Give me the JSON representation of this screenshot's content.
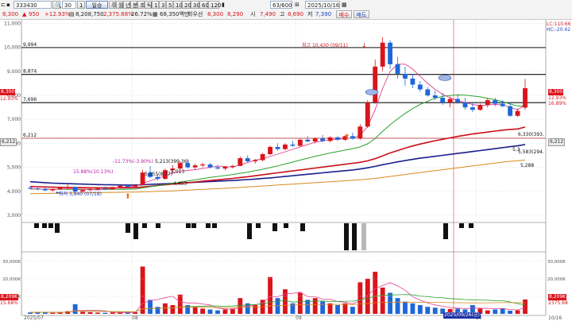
{
  "toolbar": {
    "code": "333430",
    "range": "30",
    "sub": "1",
    "price": "8,300",
    "change": "950",
    "change_pct": "+12.93%",
    "volume": "8,208,750",
    "vol_pct": "2,375.68%",
    "turnover": "26.72%",
    "amount": "68,350백만",
    "broker": "회우선",
    "bid1": "8,300",
    "bid2": "8,290",
    "open_label": "시",
    "open": "7,490",
    "high_label": "고",
    "high": "8,690",
    "low_label": "저",
    "low": "7,390",
    "buy_label": "매수",
    "sell_label": "매도",
    "period_mode": "일승",
    "periods": [
      "주",
      "월",
      "년",
      "분",
      "초",
      "틱",
      "1",
      "3",
      "5",
      "10",
      "20",
      "30",
      "60",
      "120"
    ],
    "page_count": "63/600",
    "date": "2025/10/16"
  },
  "price_axis": [
    "11,000",
    "10,000",
    "9,000",
    "8,000",
    "7,000",
    "6,000",
    "5,000",
    "4,000",
    "3,000"
  ],
  "vol_axis": [
    "30,000K",
    "20,000K",
    "10,000K"
  ],
  "x_axis": [
    "2025/07",
    "08",
    "09",
    "10",
    "10/16"
  ],
  "hlines": [
    {
      "label": "9,994",
      "v": 9994
    },
    {
      "label": "8,874",
      "v": 8874
    },
    {
      "label": "7,696",
      "v": 7696
    },
    {
      "label": "6,212",
      "v": 6212
    }
  ],
  "right_tags": {
    "lc": "LC:110.66",
    "hc": "HC:-20.42",
    "price_tag": "8,300",
    "price_pct": "12.93%",
    "pct2": "16.89%",
    "level": "6,212",
    "vol_tag": "8,209K",
    "vol_pct": "2375.68"
  },
  "left_tags": {
    "price_tag": "8,300",
    "pct": "12.93%",
    "level": "6,212",
    "vol_tag": "8,209K",
    "vol_pct": "15.68%"
  },
  "annotations": {
    "high": "최고 10,430 (09/11)",
    "low": "최저 3,940 (07/18)",
    "a1": "15.88%(10.13%)",
    "a2": "-11.73%(-3.90%)",
    "a3": "5,213(399.36)",
    "a4": "5,055(8.77)",
    "a5": "5,013",
    "a6": "4,453",
    "a7": "6,330(393.",
    "a8": "5,583(294.",
    "a9": "5,3",
    "a10": "5,288",
    "cursor_date": "2025/09/26(금)"
  },
  "colors": {
    "up": "#d9141b",
    "down": "#1e67d8",
    "ma5": "#e23f8f",
    "ma20": "#2ca22c",
    "ma60": "#c8101a",
    "ma120": "#1a1f8c",
    "ma240": "#d98a1f"
  },
  "chart_data": {
    "type": "candlestick",
    "candles": [
      [
        4150,
        4200,
        4080,
        4120
      ],
      [
        4120,
        4180,
        4050,
        4100
      ],
      [
        4100,
        4150,
        4000,
        4040
      ],
      [
        4040,
        4120,
        3990,
        4090
      ],
      [
        4090,
        4200,
        4070,
        4170
      ],
      [
        4170,
        4350,
        4100,
        4180
      ],
      [
        4180,
        4200,
        3940,
        3990
      ],
      [
        3990,
        4080,
        3960,
        4050
      ],
      [
        4050,
        4150,
        4020,
        4100
      ],
      [
        4100,
        4180,
        4060,
        4120
      ],
      [
        4120,
        4200,
        4050,
        4080
      ],
      [
        4080,
        4200,
        4070,
        4170
      ],
      [
        4170,
        4260,
        4120,
        4230
      ],
      [
        4230,
        4300,
        4170,
        4190
      ],
      [
        4190,
        4300,
        4150,
        4260
      ],
      [
        4260,
        4900,
        4250,
        4780
      ],
      [
        4780,
        5050,
        4550,
        4600
      ],
      [
        4600,
        4700,
        4450,
        4520
      ],
      [
        4520,
        4950,
        4480,
        4880
      ],
      [
        4880,
        5100,
        4800,
        4950
      ],
      [
        4950,
        5250,
        4880,
        5180
      ],
      [
        5180,
        5300,
        4950,
        5000
      ],
      [
        5000,
        5150,
        4900,
        5080
      ],
      [
        5080,
        5200,
        5000,
        5120
      ],
      [
        5120,
        5180,
        4950,
        5000
      ],
      [
        5000,
        5100,
        4900,
        4950
      ],
      [
        4950,
        5050,
        4880,
        5020
      ],
      [
        5020,
        5100,
        4950,
        5060
      ],
      [
        5060,
        5450,
        5040,
        5380
      ],
      [
        5380,
        5500,
        5200,
        5250
      ],
      [
        5250,
        5350,
        5150,
        5300
      ],
      [
        5300,
        5600,
        5250,
        5550
      ],
      [
        5550,
        5900,
        5500,
        5850
      ],
      [
        5850,
        6000,
        5700,
        5760
      ],
      [
        5760,
        6000,
        5720,
        5950
      ],
      [
        5950,
        6100,
        5850,
        5900
      ],
      [
        5900,
        6200,
        5860,
        6150
      ],
      [
        6150,
        6300,
        6050,
        6080
      ],
      [
        6080,
        6250,
        6000,
        6200
      ],
      [
        6200,
        6350,
        6050,
        6100
      ],
      [
        6100,
        6300,
        6050,
        6250
      ],
      [
        6250,
        6300,
        6100,
        6150
      ],
      [
        6150,
        6350,
        6100,
        6300
      ],
      [
        6300,
        6450,
        6150,
        6200
      ],
      [
        6200,
        6800,
        6150,
        6700
      ],
      [
        6700,
        7800,
        6650,
        7700
      ],
      [
        7700,
        9500,
        7650,
        9200
      ],
      [
        9200,
        10430,
        9000,
        10200
      ],
      [
        10200,
        10300,
        9100,
        9300
      ],
      [
        9300,
        9600,
        8700,
        8900
      ],
      [
        8900,
        9200,
        8400,
        8700
      ],
      [
        8700,
        8900,
        8300,
        8450
      ],
      [
        8450,
        8600,
        8150,
        8250
      ],
      [
        8250,
        8350,
        7950,
        8000
      ],
      [
        8000,
        8200,
        7800,
        7900
      ],
      [
        7900,
        8100,
        7600,
        7700
      ],
      [
        7700,
        7950,
        7500,
        7850
      ],
      [
        7850,
        8050,
        7650,
        7700
      ],
      [
        7700,
        7900,
        7400,
        7500
      ],
      [
        7500,
        7700,
        7300,
        7400
      ],
      [
        7400,
        7650,
        7350,
        7600
      ],
      [
        7600,
        7900,
        7500,
        7800
      ],
      [
        7800,
        7900,
        7550,
        7650
      ],
      [
        7650,
        7800,
        7500,
        7550
      ],
      [
        7550,
        7700,
        7100,
        7150
      ],
      [
        7150,
        7450,
        7100,
        7350
      ],
      [
        7490,
        8690,
        7390,
        8300
      ]
    ],
    "volume_k": [
      800,
      900,
      1100,
      600,
      700,
      1500,
      5500,
      1200,
      900,
      700,
      600,
      800,
      900,
      700,
      1000,
      27000,
      8000,
      4000,
      6000,
      5000,
      11000,
      5000,
      4000,
      3000,
      2500,
      2000,
      2500,
      3000,
      9000,
      6000,
      5000,
      8000,
      21000,
      9000,
      14000,
      6000,
      12000,
      8000,
      9000,
      7000,
      6000,
      5000,
      6000,
      4000,
      18000,
      20000,
      24000,
      15000,
      12000,
      9000,
      7000,
      6000,
      5000,
      4000,
      3500,
      3000,
      2800,
      3000,
      2500,
      5000,
      3000,
      2000,
      2500,
      3000,
      1800,
      2000,
      8209
    ],
    "ma120": [
      4400,
      4380,
      4360,
      4340,
      4330,
      4320,
      4310,
      4300,
      4290,
      4280,
      4275,
      4270,
      4265,
      4262,
      4260,
      4275,
      4290,
      4300,
      4315,
      4330,
      4345,
      4360,
      4375,
      4390,
      4405,
      4420,
      4435,
      4450,
      4470,
      4490,
      4510,
      4535,
      4560,
      4590,
      4620,
      4650,
      4680,
      4710,
      4740,
      4770,
      4800,
      4830,
      4860,
      4890,
      4930,
      4980,
      5040,
      5110,
      5170,
      5230,
      5280,
      5330,
      5380,
      5420,
      5460,
      5500,
      5540,
      5580,
      5620,
      5660,
      5700,
      5740,
      5780,
      5820,
      5860,
      5900,
      5950
    ],
    "ma240": [
      3900,
      3905,
      3910,
      3915,
      3920,
      3925,
      3930,
      3935,
      3940,
      3945,
      3950,
      3955,
      3960,
      3965,
      3970,
      3980,
      3990,
      4000,
      4010,
      4020,
      4035,
      4050,
      4065,
      4080,
      4095,
      4110,
      4125,
      4140,
      4160,
      4180,
      4200,
      4220,
      4240,
      4260,
      4280,
      4300,
      4320,
      4340,
      4360,
      4380,
      4400,
      4420,
      4440,
      4460,
      4480,
      4510,
      4540,
      4580,
      4620,
      4660,
      4700,
      4740,
      4780,
      4820,
      4860,
      4900,
      4940,
      4980,
      5020,
      5060,
      5100,
      5140,
      5180,
      5220,
      5250,
      5270,
      5300
    ],
    "ma60": [
      4200,
      4190,
      4180,
      4170,
      4165,
      4160,
      4155,
      4150,
      4148,
      4146,
      4145,
      4145,
      4146,
      4148,
      4150,
      4180,
      4210,
      4240,
      4270,
      4300,
      4330,
      4360,
      4390,
      4420,
      4450,
      4480,
      4510,
      4540,
      4575,
      4610,
      4650,
      4690,
      4730,
      4770,
      4810,
      4850,
      4890,
      4930,
      4970,
      5010,
      5050,
      5090,
      5130,
      5170,
      5210,
      5270,
      5360,
      5480,
      5600,
      5700,
      5800,
      5890,
      5970,
      6040,
      6110,
      6170,
      6230,
      6290,
      6340,
      6390,
      6430,
      6470,
      6510,
      6550,
      6580,
      6600,
      6680
    ],
    "ma20": [
      4100,
      4095,
      4090,
      4085,
      4085,
      4090,
      4080,
      4075,
      4075,
      4078,
      4080,
      4082,
      4085,
      4090,
      4095,
      4140,
      4190,
      4230,
      4280,
      4330,
      4380,
      4430,
      4480,
      4530,
      4580,
      4620,
      4660,
      4700,
      4750,
      4800,
      4860,
      4920,
      4990,
      5060,
      5140,
      5220,
      5300,
      5380,
      5460,
      5530,
      5600,
      5660,
      5720,
      5780,
      5850,
      5980,
      6200,
      6500,
      6780,
      7020,
      7250,
      7450,
      7620,
      7760,
      7880,
      7960,
      8000,
      8020,
      8010,
      7980,
      7940,
      7880,
      7820,
      7740,
      7640,
      7560,
      7550
    ],
    "ma5": [
      4100,
      4100,
      4090,
      4080,
      4090,
      4110,
      4100,
      4090,
      4080,
      4060,
      4090,
      4120,
      4160,
      4190,
      4210,
      4330,
      4440,
      4540,
      4650,
      4760,
      4840,
      4870,
      4900,
      4950,
      5000,
      5050,
      5030,
      5010,
      5100,
      5200,
      5300,
      5350,
      5450,
      5550,
      5650,
      5750,
      5850,
      5950,
      6050,
      6100,
      6150,
      6180,
      6200,
      6220,
      6350,
      6700,
      7400,
      8300,
      9000,
      9300,
      9300,
      9100,
      8800,
      8500,
      8250,
      8050,
      7900,
      7780,
      7700,
      7620,
      7580,
      7600,
      7620,
      7600,
      7500,
      7400,
      7600
    ]
  }
}
